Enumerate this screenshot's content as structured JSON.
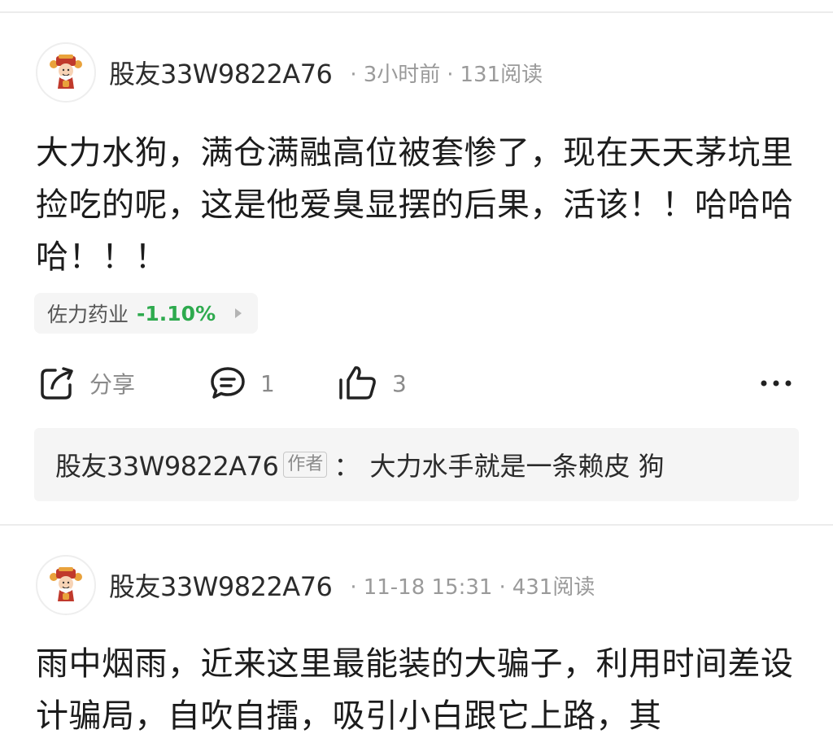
{
  "posts": [
    {
      "username": "股友33W9822A76",
      "time": "3小时前",
      "reads": "131阅读",
      "text": "大力水狗，满仓满融高位被套惨了，现在天天茅坑里捡吃的呢，这是他爱臭显摆的后果，活该！！哈哈哈哈！！！",
      "stock": {
        "name": "佐力药业",
        "change": "-1.10%",
        "change_color": "#2eaa4e"
      },
      "actions": {
        "share_label": "分享",
        "comment_count": "1",
        "like_count": "3"
      },
      "reply": {
        "user": "股友33W9822A76",
        "badge": "作者",
        "separator": "：",
        "text": "大力水手就是一条赖皮 狗"
      }
    },
    {
      "username": "股友33W9822A76",
      "time": "11-18 15:31",
      "reads": "431阅读",
      "text": "雨中烟雨，近来这里最能装的大骗子，利用时间差设计骗局，自吹自擂，吸引小白跟它上路，其"
    }
  ],
  "icons": {
    "avatar": "fortune-god-avatar-icon",
    "share": "share-icon",
    "comment": "comment-icon",
    "like": "thumbs-up-icon",
    "more": "more-dots-icon",
    "stock_arrow": "triangle-right-icon"
  },
  "colors": {
    "stock_down": "#2eaa4e",
    "meta_text": "#9a9a9a",
    "reply_bg": "#f5f5f5"
  }
}
